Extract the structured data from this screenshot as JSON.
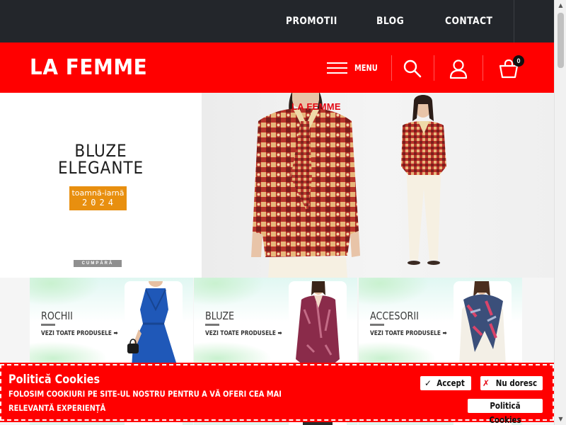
{
  "topnav": {
    "items": [
      "PROMOTII",
      "BLOG",
      "CONTACT"
    ]
  },
  "header": {
    "logo": "LA FEMME",
    "menu_label": "MENU",
    "cart_count": "0"
  },
  "hero": {
    "title_line1": "BLUZE",
    "title_line2": "ELEGANTE",
    "season_line1": "toamnă-iarnă",
    "season_line2": "2024",
    "buy_label": "CUMPĂRĂ",
    "brand_tag": "LA FEMME"
  },
  "categories": [
    {
      "title": "ROCHII",
      "link": "VEZI TOATE PRODUSELE ➡"
    },
    {
      "title": "BLUZE",
      "link": "VEZI TOATE PRODUSELE ➡"
    },
    {
      "title": "ACCESORII",
      "link": "VEZI TOATE PRODUSELE ➡"
    }
  ],
  "cookie": {
    "title": "Politică Cookies",
    "text": "FOLOSIM COOKIURI PE SITE-UL NOSTRU PENTRU A VĂ OFERI CEA MAI RELEVANTĂ EXPERIENȚĂ",
    "accept_label": "Accept",
    "decline_label": "Nu doresc",
    "policy_label": "Politică Cookies"
  },
  "icons": {
    "menu": "hamburger-icon",
    "search": "search-icon",
    "account": "user-icon",
    "cart": "shopping-bag-icon",
    "arrow": "arrow-right-icon"
  },
  "colors": {
    "topbar": "#23262b",
    "brand_red": "#ff0000",
    "season_orange": "#e88f0f"
  }
}
